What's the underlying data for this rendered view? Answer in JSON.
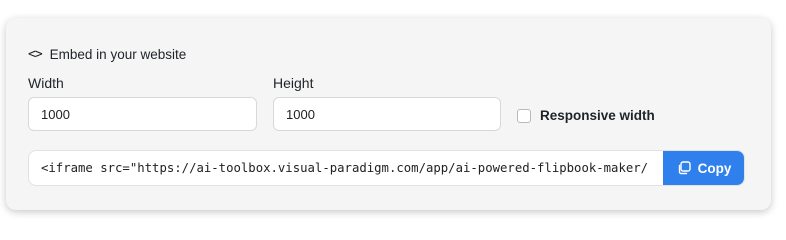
{
  "section": {
    "title": "Embed in your website",
    "icon": "code-icon"
  },
  "fields": {
    "width_label": "Width",
    "width_value": "1000",
    "height_label": "Height",
    "height_value": "1000",
    "responsive_label": "Responsive width",
    "responsive_checked": false
  },
  "embed": {
    "code": "<iframe src=\"https://ai-toolbox.visual-paradigm.com/app/ai-powered-flipbook-maker/",
    "copy_label": "Copy",
    "copy_icon": "copy-icon"
  },
  "colors": {
    "accent": "#2f80ed",
    "card_background": "#f5f5f6"
  }
}
